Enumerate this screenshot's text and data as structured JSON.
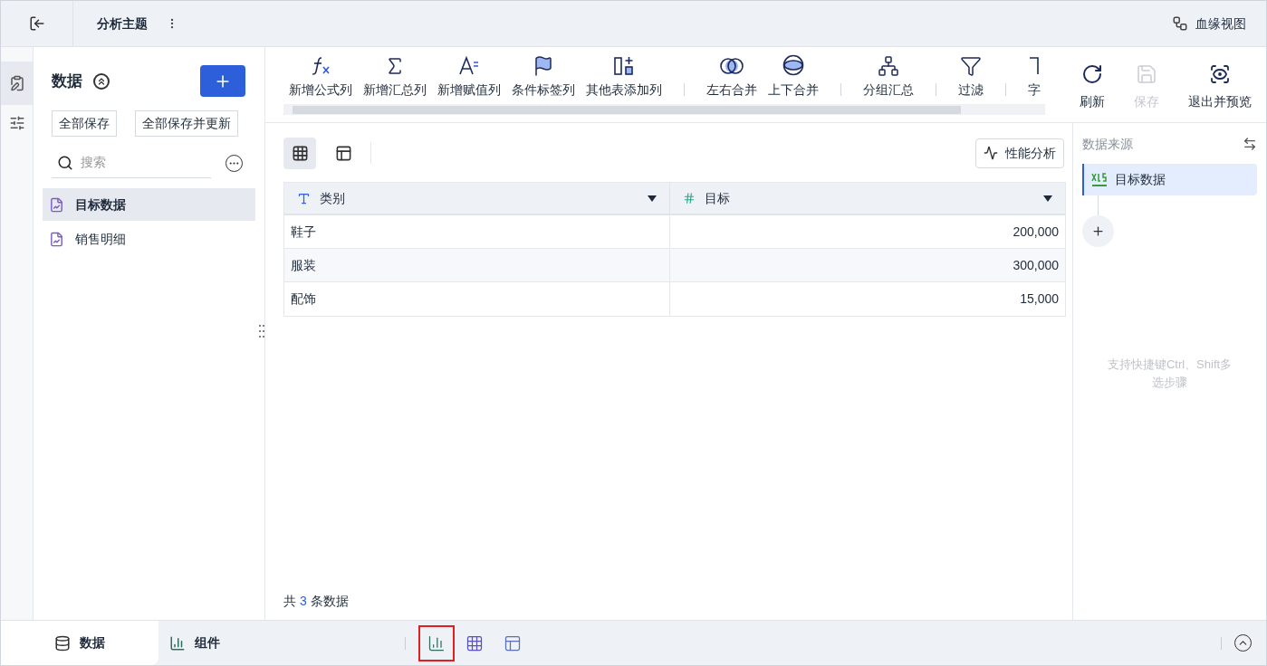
{
  "topbar": {
    "title": "分析主题",
    "lineage": "血缘视图"
  },
  "sidebar": {
    "title": "数据",
    "buttons": [
      "全部保存",
      "全部保存并更新"
    ],
    "search": {
      "placeholder": "搜索"
    },
    "items": [
      {
        "label": "目标数据",
        "selected": true
      },
      {
        "label": "销售明细",
        "selected": false
      }
    ]
  },
  "toolbar_groups": [
    [
      "新增公式列",
      "新增汇总列",
      "新增赋值列",
      "条件标签列",
      "其他表添加列"
    ],
    [
      "左右合并",
      "上下合并"
    ],
    [
      "分组汇总"
    ],
    [
      "过滤"
    ],
    [
      "字"
    ]
  ],
  "actions": [
    {
      "label": "刷新",
      "disabled": false
    },
    {
      "label": "保存",
      "disabled": true
    },
    {
      "label": "退出并预览",
      "disabled": false
    }
  ],
  "view_toggles": [
    {
      "selected": true
    },
    {
      "selected": false
    }
  ],
  "perf_button": "性能分析",
  "table": {
    "columns": [
      {
        "label": "类别",
        "kind": "text"
      },
      {
        "label": "目标",
        "kind": "number"
      }
    ],
    "rows": [
      [
        "鞋子",
        "200,000"
      ],
      [
        "服装",
        "300,000"
      ],
      [
        "配饰",
        "15,000"
      ]
    ]
  },
  "footer": {
    "prefix": "共",
    "count": "3",
    "suffix": "条数据"
  },
  "source_panel": {
    "title": "数据来源",
    "steps": [
      {
        "label": "目标数据",
        "selected": true
      }
    ],
    "hint": "支持快捷键Ctrl、Shift多选步骤"
  },
  "bottom_tabs": [
    {
      "label": "数据",
      "selected": true
    },
    {
      "label": "组件",
      "selected": false
    }
  ],
  "bottom_tools": [
    {
      "highlighted": true
    },
    {
      "highlighted": false
    },
    {
      "highlighted": false
    }
  ]
}
